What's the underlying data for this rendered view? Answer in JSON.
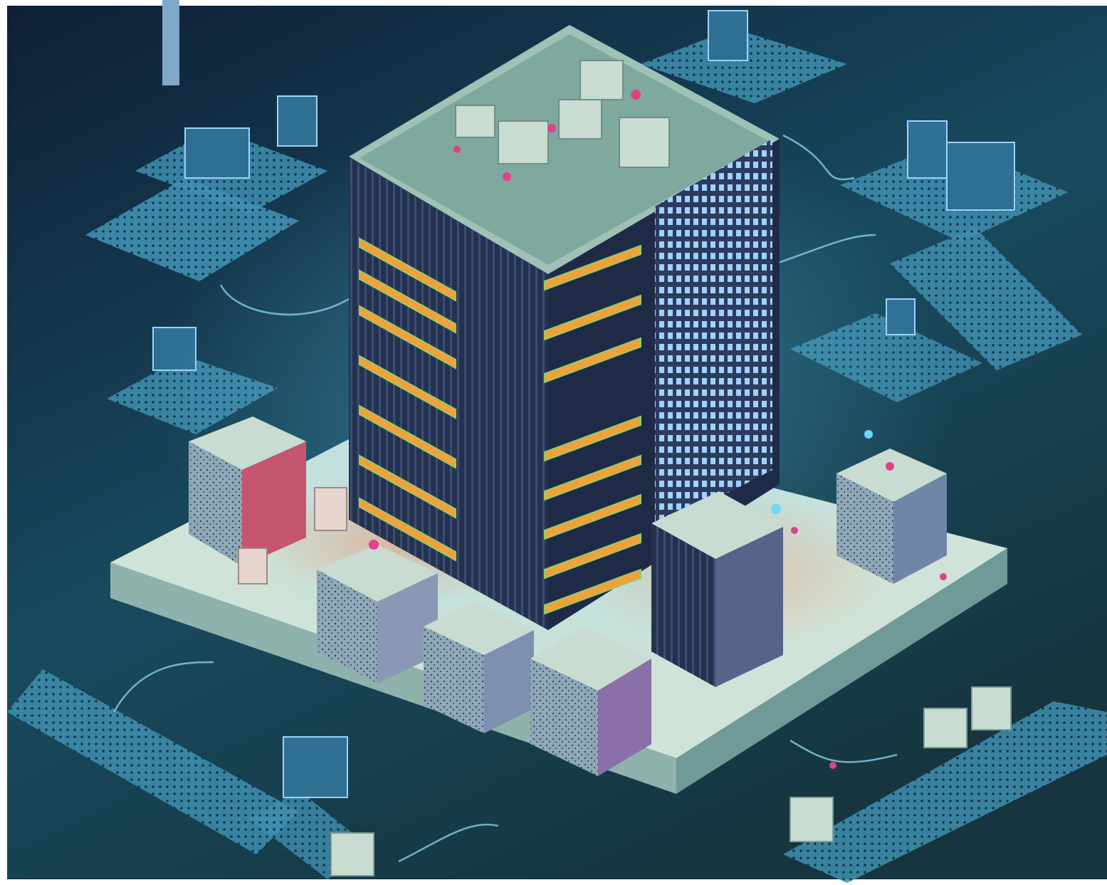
{
  "scene": {
    "subject": "server-building",
    "palette": {
      "background_top": "#112238",
      "background_bottom": "#1c5a6a",
      "platform": "#cfe3d8",
      "platform_side": "#8fb2ad",
      "tower_dark": "#2c3b5e",
      "tower_top": "#9fc1b6",
      "window_glow": "#9fd2ff",
      "rack_orange": "#f3a03a",
      "rack_green": "#8fcf66",
      "accent_magenta": "#e0408a",
      "accent_cyan": "#6fd6ff",
      "grid_mat": "#3f8fb0",
      "bookmark_bar": "#7fa7c8"
    },
    "icons": [
      "monitor-icon",
      "server-cube-icon",
      "network-cable-icon",
      "grid-mat-icon"
    ]
  }
}
